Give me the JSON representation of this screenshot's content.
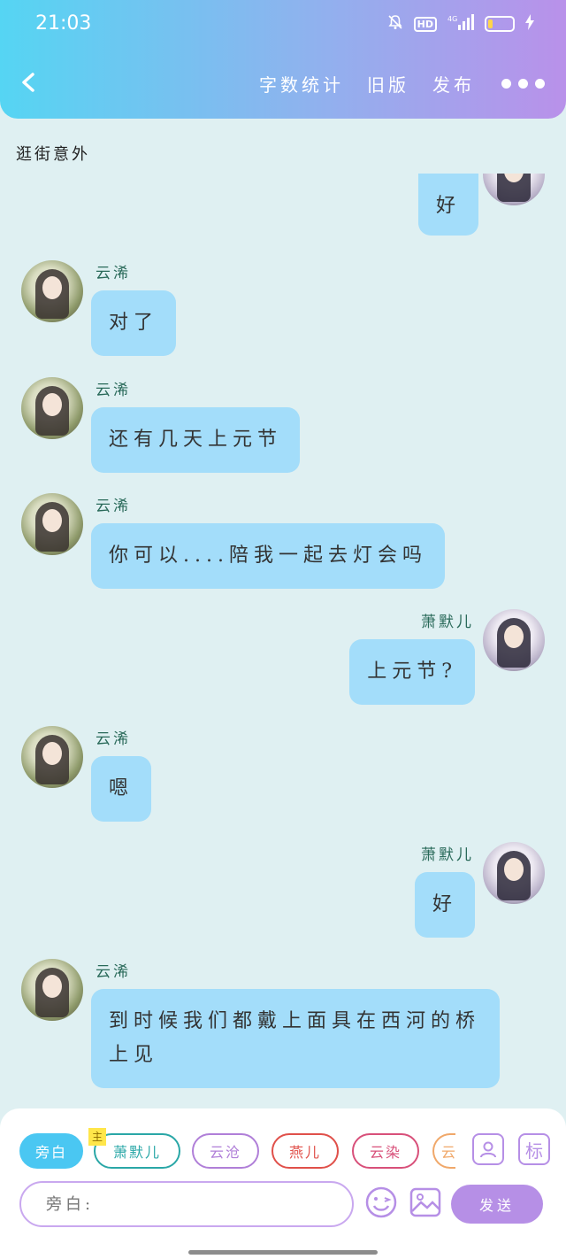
{
  "status_bar": {
    "time": "21:03",
    "hd": "HD",
    "network": "4G",
    "battery_level": 0.2
  },
  "header": {
    "actions": [
      "字数统计",
      "旧版",
      "发布"
    ]
  },
  "chapter_title": "逛街意外",
  "messages": [
    {
      "side": "right",
      "sender": "",
      "text": "好"
    },
    {
      "side": "left",
      "sender": "云浠",
      "text": "对了"
    },
    {
      "side": "left",
      "sender": "云浠",
      "text": "还有几天上元节"
    },
    {
      "side": "left",
      "sender": "云浠",
      "text": "你可以....陪我一起去灯会吗"
    },
    {
      "side": "right",
      "sender": "萧默儿",
      "text": "上元节?"
    },
    {
      "side": "left",
      "sender": "云浠",
      "text": "嗯"
    },
    {
      "side": "right",
      "sender": "萧默儿",
      "text": "好"
    },
    {
      "side": "left",
      "sender": "云浠",
      "text": "到时候我们都戴上面具在西河的桥上见"
    }
  ],
  "characters": [
    {
      "label": "旁白",
      "color": "#4ac7f2"
    },
    {
      "label": "萧默儿",
      "color": "#2aa7a7",
      "main_tag": "主"
    },
    {
      "label": "云沧",
      "color": "#b07fd8"
    },
    {
      "label": "燕儿",
      "color": "#e0504a"
    },
    {
      "label": "云染",
      "color": "#d8507a"
    },
    {
      "label": "云",
      "color": "#f0a86a"
    }
  ],
  "toolbar": {
    "tag_label": "标"
  },
  "input": {
    "placeholder": "旁白:"
  },
  "send_label": "发送"
}
